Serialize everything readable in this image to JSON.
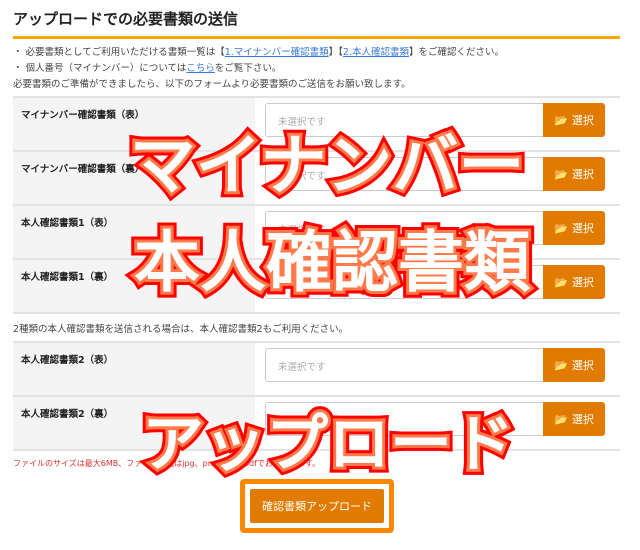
{
  "title": "アップロードでの必要書類の送信",
  "notes": {
    "line1_pre": "・ 必要書類としてご利用いただける書類一覧は【",
    "link1": "1.マイナンバー確認書類",
    "mid": "】【",
    "link2": "2.本人確認書類",
    "line1_post": "】をご確認ください。",
    "line2_pre": "・ 個人番号（マイナンバー）については",
    "link3": "こちら",
    "line2_post": "をご覧下さい。"
  },
  "intro": "必要書類のご準備ができましたら、以下のフォームより必要書類のご送信をお願い致します。",
  "placeholder": "未選択です",
  "select_label": "選択",
  "rows1": [
    {
      "label": "マイナンバー確認書類（表）"
    },
    {
      "label": "マイナンバー確認書類（裏）"
    },
    {
      "label": "本人確認書類1（表）"
    },
    {
      "label": "本人確認書類1（裏）"
    }
  ],
  "mid_note": "2種類の本人確認書類を送信される場合は、本人確認書類2もご利用ください。",
  "rows2": [
    {
      "label": "本人確認書類2（表）"
    },
    {
      "label": "本人確認書類2（裏）"
    }
  ],
  "warning": "ファイルのサイズは最大6MB、ファイル形式はjpg、png、gif、pdfでお願いします。",
  "submit_label": "確認書類アップロード",
  "overlay": {
    "line1": "マイナンバー",
    "line2": "本人確認書類",
    "line3": "アップロード"
  },
  "colors": {
    "accent": "#e07b00",
    "rule": "#f5a800",
    "highlight": "#ff8800"
  }
}
